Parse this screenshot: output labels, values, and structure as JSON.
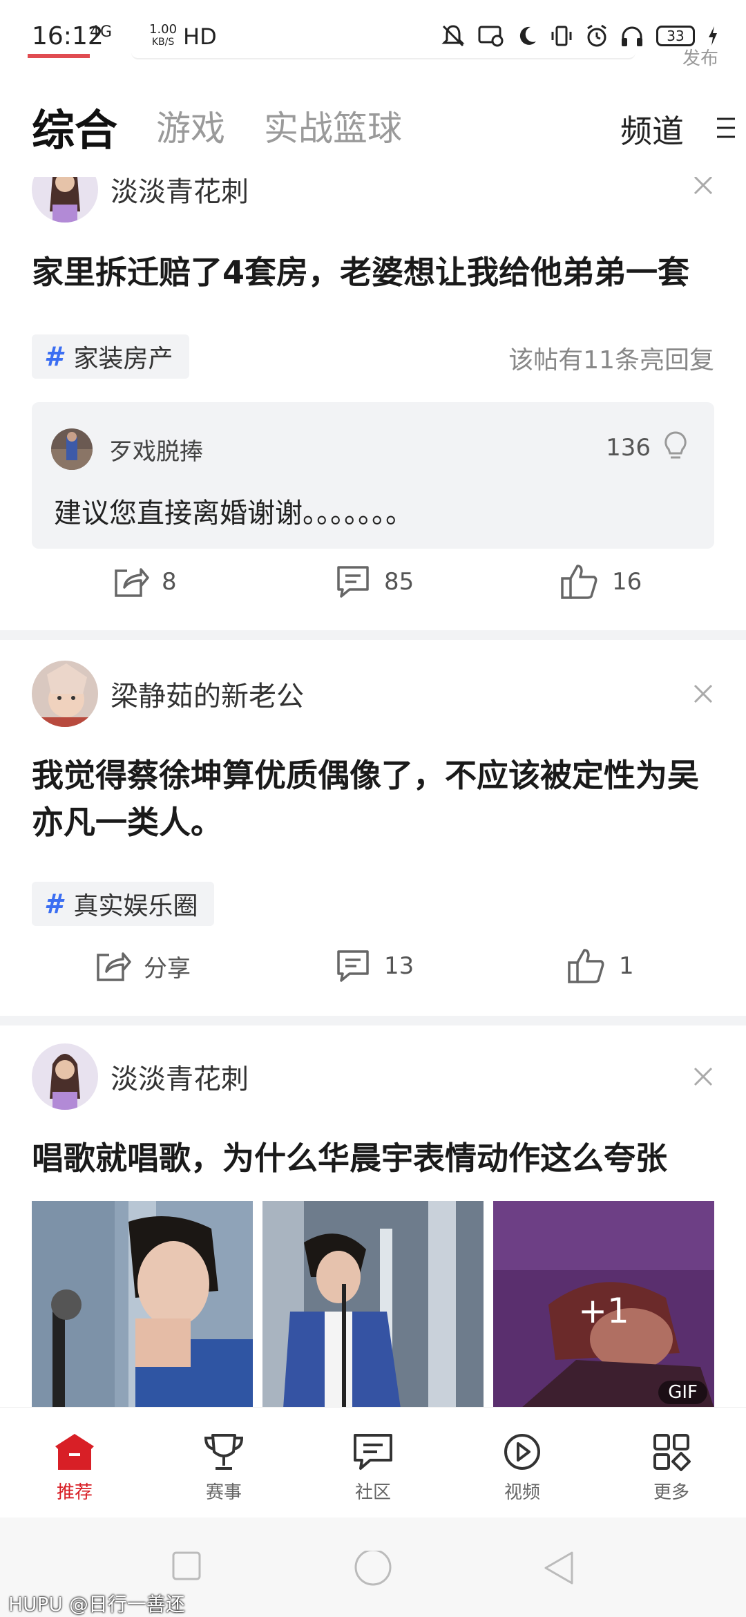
{
  "status_bar": {
    "time": "16:12",
    "network": "4G",
    "speed_value": "1.00",
    "speed_unit": "KB/S",
    "hd": "HD",
    "battery": "33",
    "icons": [
      "mute-icon",
      "screen-cast-icon",
      "moon-icon",
      "vibrate-icon",
      "alarm-icon",
      "headphones-icon",
      "battery-icon",
      "charging-icon"
    ]
  },
  "top_hint": "发布",
  "tabs": {
    "items": [
      {
        "label": "综合",
        "active": true
      },
      {
        "label": "游戏",
        "active": false
      },
      {
        "label": "实战篮球",
        "active": false
      }
    ],
    "channel_label": "频道"
  },
  "posts": [
    {
      "author": "淡淡青花刺",
      "title": "家里拆迁赔了4套房，老婆想让我给他弟弟一套",
      "topic": "家装房产",
      "lit_replies": "该帖有11条亮回复",
      "hot_reply": {
        "author": "歹戏脱捧",
        "likes": "136",
        "text": "建议您直接离婚谢谢。。。。。。。"
      },
      "share_count": "8",
      "comment_count": "85",
      "like_count": "16"
    },
    {
      "author": "梁静茹的新老公",
      "title": "我觉得蔡徐坤算优质偶像了，不应该被定性为吴亦凡一类人。",
      "topic": "真实娱乐圈",
      "share_label": "分享",
      "comment_count": "13",
      "like_count": "1"
    },
    {
      "author": "淡淡青花刺",
      "title": "唱歌就唱歌，为什么华晨宇表情动作这么夸张",
      "more_images": "+1",
      "gif_badge": "GIF"
    }
  ],
  "bottom_nav": {
    "items": [
      {
        "label": "推荐",
        "icon": "home-icon",
        "active": true
      },
      {
        "label": "赛事",
        "icon": "trophy-icon",
        "active": false
      },
      {
        "label": "社区",
        "icon": "community-icon",
        "active": false
      },
      {
        "label": "视频",
        "icon": "play-icon",
        "active": false
      },
      {
        "label": "更多",
        "icon": "grid-icon",
        "active": false
      }
    ]
  },
  "watermark": "HUPU @日行一善还",
  "colors": {
    "accent": "#d81f26",
    "topic_hash": "#3b6ef2",
    "muted": "#9a9a9a",
    "card_bg": "#f2f3f5"
  }
}
